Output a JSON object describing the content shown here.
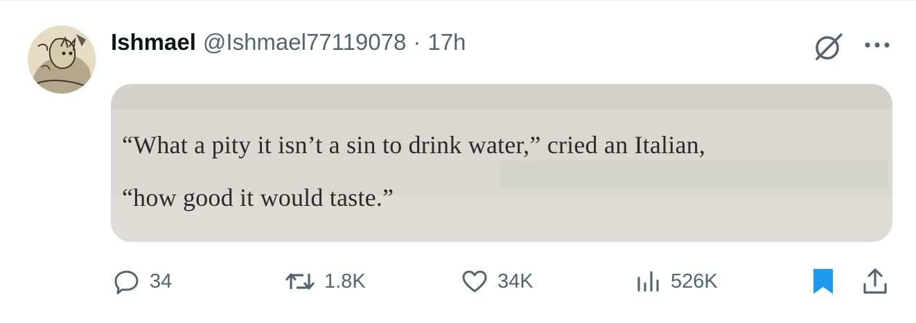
{
  "author": {
    "display_name": "Ishmael",
    "handle": "@Ishmael77119078",
    "separator": "·",
    "time": "17h"
  },
  "photo": {
    "lines": [
      "“What a pity it isn’t a sin to drink water,” cried an Italian,",
      "“how good it would taste.”"
    ]
  },
  "actions": {
    "replies": "34",
    "reposts": "1.8K",
    "likes": "34K",
    "views": "526K"
  },
  "icons": {
    "grok": "grok-slash-circle-icon",
    "more": "more-dots-icon",
    "reply": "speech-bubble-icon",
    "repost": "retweet-arrows-icon",
    "like": "heart-icon",
    "views": "bar-chart-icon",
    "bookmark": "bookmark-filled-icon",
    "share": "share-upload-icon"
  },
  "colors": {
    "text": "#0f1419",
    "muted": "#536471",
    "bookmark_blue": "#1d9bf0"
  }
}
